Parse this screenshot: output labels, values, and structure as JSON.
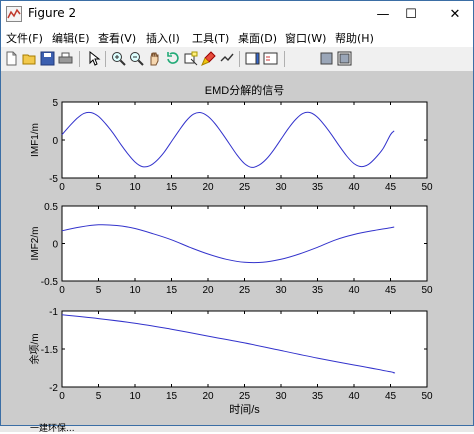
{
  "window": {
    "title": "Figure 2",
    "controls": {
      "minimize": "—",
      "maximize": "☐",
      "close": "✕"
    }
  },
  "menu": [
    {
      "label": "文件(F)"
    },
    {
      "label": "编辑(E)"
    },
    {
      "label": "查看(V)"
    },
    {
      "label": "插入(I)"
    },
    {
      "label": "工具(T)"
    },
    {
      "label": "桌面(D)"
    },
    {
      "label": "窗口(W)"
    },
    {
      "label": "帮助(H)"
    }
  ],
  "toolbar": {
    "icons": [
      "new-figure-icon",
      "open-file-icon",
      "save-icon",
      "print-icon",
      "edit-plot-arrow-icon",
      "zoom-in-icon",
      "zoom-out-icon",
      "pan-hand-icon",
      "rotate-3d-icon",
      "data-cursor-icon",
      "brush-icon",
      "link-plot-icon",
      "insert-colorbar-icon",
      "insert-legend-icon",
      "hide-plot-tools-icon",
      "show-plot-tools-icon"
    ]
  },
  "figure": {
    "background": "#cccccc",
    "line_color": "#3333cc",
    "title": "EMD分解的信号",
    "xlabel": "时间/s"
  },
  "chart_data": [
    {
      "type": "line",
      "title": "EMD分解的信号",
      "ylabel": "IMF1/m",
      "xlabel": "",
      "xlim": [
        0,
        50
      ],
      "ylim": [
        -5,
        5
      ],
      "xticks": [
        "0",
        "5",
        "10",
        "15",
        "20",
        "25",
        "30",
        "35",
        "40",
        "45",
        "50"
      ],
      "yticks": [
        "-5",
        "0",
        "5"
      ],
      "grid": false,
      "series": [
        {
          "x": [
            0,
            1,
            2,
            3,
            4,
            5,
            6,
            7,
            8,
            9,
            10,
            11,
            12,
            13,
            14,
            15,
            16,
            17,
            18,
            19,
            20,
            21,
            22,
            23,
            24,
            25,
            26,
            27,
            28,
            29,
            30,
            31,
            32,
            33,
            34,
            35,
            36,
            37,
            38,
            39,
            40,
            41,
            42,
            43,
            44,
            45,
            45.5
          ],
          "values": [
            0.7,
            1.8,
            2.8,
            3.5,
            3.6,
            3.1,
            2.1,
            0.9,
            -0.5,
            -1.8,
            -2.9,
            -3.5,
            -3.4,
            -2.7,
            -1.6,
            -0.2,
            1.2,
            2.5,
            3.4,
            3.6,
            3.1,
            2.1,
            0.8,
            -0.6,
            -2.0,
            -3.1,
            -3.6,
            -3.3,
            -2.5,
            -1.3,
            0.1,
            1.5,
            2.7,
            3.5,
            3.6,
            3.0,
            1.9,
            0.6,
            -0.8,
            -2.1,
            -3.1,
            -3.5,
            -3.2,
            -2.3,
            -1.1,
            0.7,
            1.2
          ]
        }
      ]
    },
    {
      "type": "line",
      "title": "",
      "ylabel": "IMF2/m",
      "xlabel": "",
      "xlim": [
        0,
        50
      ],
      "ylim": [
        -0.5,
        0.5
      ],
      "xticks": [
        "0",
        "5",
        "10",
        "15",
        "20",
        "25",
        "30",
        "35",
        "40",
        "45",
        "50"
      ],
      "yticks": [
        "-0.5",
        "0",
        "0.5"
      ],
      "grid": false,
      "series": [
        {
          "x": [
            0,
            2.5,
            5,
            7.5,
            10,
            12.5,
            15,
            17.5,
            20,
            22.5,
            25,
            27.5,
            30,
            32.5,
            35,
            37.5,
            40,
            42.5,
            45,
            45.5
          ],
          "values": [
            0.17,
            0.22,
            0.25,
            0.24,
            0.2,
            0.13,
            0.05,
            -0.05,
            -0.14,
            -0.21,
            -0.25,
            -0.25,
            -0.21,
            -0.14,
            -0.05,
            0.05,
            0.12,
            0.17,
            0.21,
            0.22
          ]
        }
      ]
    },
    {
      "type": "line",
      "title": "",
      "ylabel": "余项/m",
      "xlabel": "时间/s",
      "xlim": [
        0,
        50
      ],
      "ylim": [
        -2,
        -1
      ],
      "xticks": [
        "0",
        "5",
        "10",
        "15",
        "20",
        "25",
        "30",
        "35",
        "40",
        "45",
        "50"
      ],
      "yticks": [
        "-2",
        "-1.5",
        "-1"
      ],
      "grid": false,
      "series": [
        {
          "x": [
            0,
            5,
            10,
            15,
            20,
            25,
            30,
            35,
            40,
            45,
            45.5
          ],
          "values": [
            -1.05,
            -1.1,
            -1.16,
            -1.24,
            -1.33,
            -1.42,
            -1.52,
            -1.62,
            -1.71,
            -1.8,
            -1.82
          ]
        }
      ]
    }
  ],
  "taskbar": {
    "text": "一建环保..."
  }
}
